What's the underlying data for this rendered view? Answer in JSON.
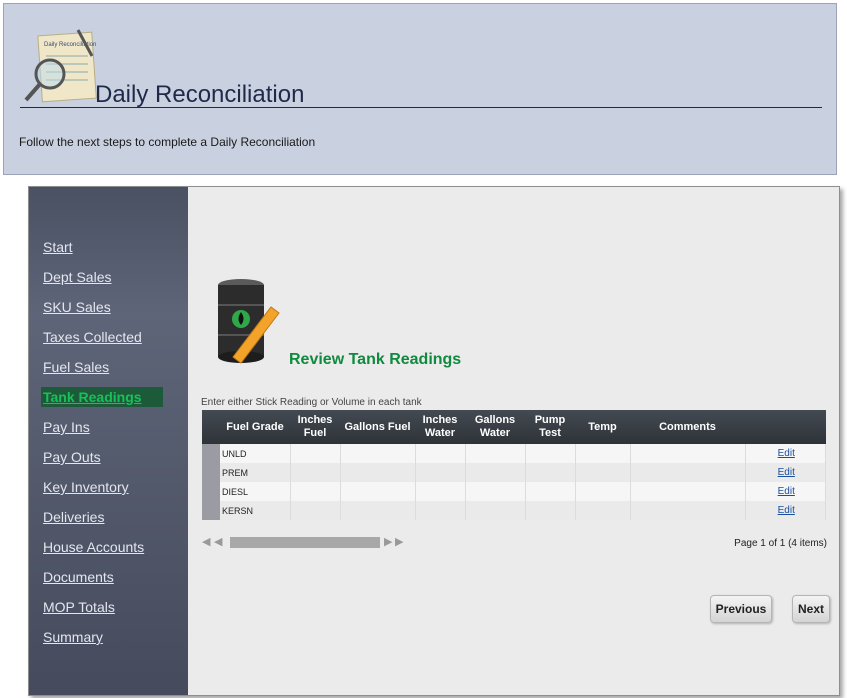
{
  "header": {
    "title": "Daily Reconciliation",
    "subtitle": "Follow the next steps to complete a Daily Reconciliation",
    "icon": "document-magnifier-icon",
    "icon_text": "Daily Reconciliation"
  },
  "sidebar": {
    "items": [
      {
        "label": "Start"
      },
      {
        "label": "Dept Sales"
      },
      {
        "label": "SKU Sales"
      },
      {
        "label": "Taxes Collected"
      },
      {
        "label": "Fuel Sales"
      },
      {
        "label": "Tank Readings",
        "active": true
      },
      {
        "label": "Pay Ins"
      },
      {
        "label": "Pay Outs"
      },
      {
        "label": "Key Inventory"
      },
      {
        "label": "Deliveries"
      },
      {
        "label": "House Accounts"
      },
      {
        "label": "Documents"
      },
      {
        "label": "MOP Totals"
      },
      {
        "label": "Summary"
      }
    ]
  },
  "section": {
    "title": "Review Tank Readings",
    "icon": "oil-barrel-icon",
    "hint": "Enter either Stick Reading or Volume in each tank"
  },
  "table": {
    "columns": [
      "Fuel Grade",
      "Inches Fuel",
      "Gallons Fuel",
      "Inches Water",
      "Gallons Water",
      "Pump Test",
      "Temp",
      "Comments",
      ""
    ],
    "rows": [
      {
        "grade": "UNLD",
        "edit": "Edit"
      },
      {
        "grade": "PREM",
        "edit": "Edit"
      },
      {
        "grade": "DIESL",
        "edit": "Edit"
      },
      {
        "grade": "KERSN",
        "edit": "Edit"
      }
    ]
  },
  "pager": {
    "info": "Page 1 of 1 (4 items)"
  },
  "buttons": {
    "previous": "Previous",
    "next": "Next"
  },
  "colors": {
    "header_bg": "#c9d0df",
    "sidebar_active": "#19c05a",
    "section_title": "#0f8a3e",
    "link": "#1a4fa0"
  }
}
